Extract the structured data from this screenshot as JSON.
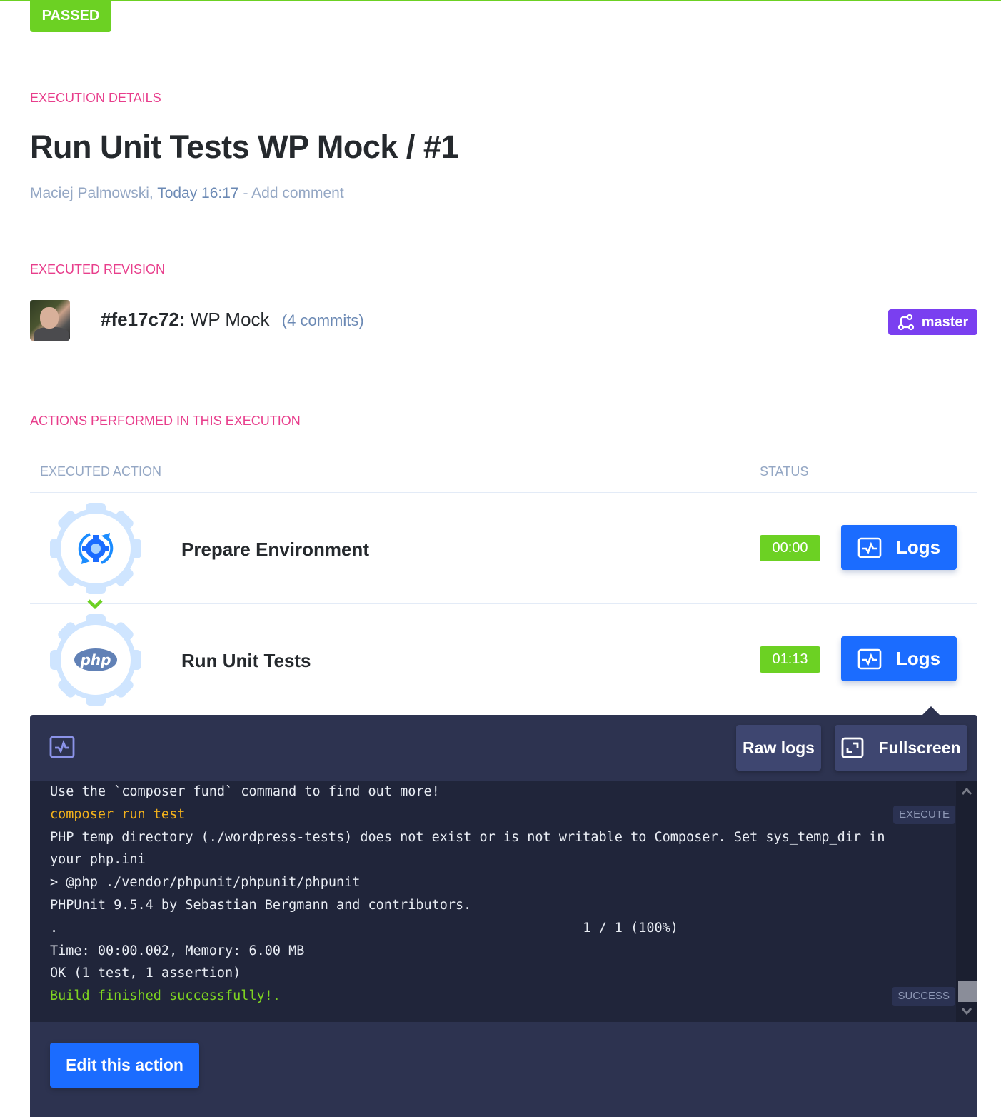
{
  "status_badge": "PASSED",
  "execution_details": {
    "label": "EXECUTION DETAILS",
    "title": "Run Unit Tests WP Mock / #1",
    "author": "Maciej Palmowski,",
    "time": "Today 16:17",
    "separator": " - ",
    "add_comment": "Add comment"
  },
  "executed_revision": {
    "label": "EXECUTED REVISION",
    "hash": "#fe17c72:",
    "message": "WP Mock",
    "commits": "(4 commits)",
    "branch": "master"
  },
  "actions": {
    "label": "ACTIONS PERFORMED IN THIS EXECUTION",
    "columns": [
      "EXECUTED ACTION",
      "STATUS"
    ],
    "rows": [
      {
        "name": "Prepare Environment",
        "icon": "environment-gear-icon",
        "duration": "00:00",
        "logs_label": "Logs"
      },
      {
        "name": "Run Unit Tests",
        "icon": "php-icon",
        "duration": "01:13",
        "logs_label": "Logs"
      }
    ]
  },
  "log_panel": {
    "raw_logs_label": "Raw logs",
    "fullscreen_label": "Fullscreen",
    "lines": [
      {
        "text": "Use the `composer fund` command to find out more!",
        "type": "normal",
        "tag": ""
      },
      {
        "text": "composer run test",
        "type": "cmd",
        "tag": "EXECUTE"
      },
      {
        "text": "PHP temp directory (./wordpress-tests) does not exist or is not writable to Composer. Set sys_temp_dir in",
        "type": "normal",
        "tag": ""
      },
      {
        "text": "your php.ini",
        "type": "normal",
        "tag": ""
      },
      {
        "text": "> @php ./vendor/phpunit/phpunit/phpunit",
        "type": "normal",
        "tag": ""
      },
      {
        "text": "PHPUnit 9.5.4 by Sebastian Bergmann and contributors.",
        "type": "normal",
        "tag": ""
      },
      {
        "text": ".                                                                  1 / 1 (100%)",
        "type": "normal",
        "tag": ""
      },
      {
        "text": "Time: 00:00.002, Memory: 6.00 MB",
        "type": "normal",
        "tag": ""
      },
      {
        "text": "OK (1 test, 1 assertion)",
        "type": "normal",
        "tag": ""
      },
      {
        "text": "Build finished successfully!.",
        "type": "ok",
        "tag": "SUCCESS"
      }
    ],
    "edit_label": "Edit this action"
  },
  "colors": {
    "passed": "#6cd123",
    "accent_pink": "#e83e8c",
    "primary_blue": "#1b6cff",
    "branch_purple": "#7a3ff0",
    "panel_bg": "#2d3350",
    "console_bg": "#20253a"
  }
}
